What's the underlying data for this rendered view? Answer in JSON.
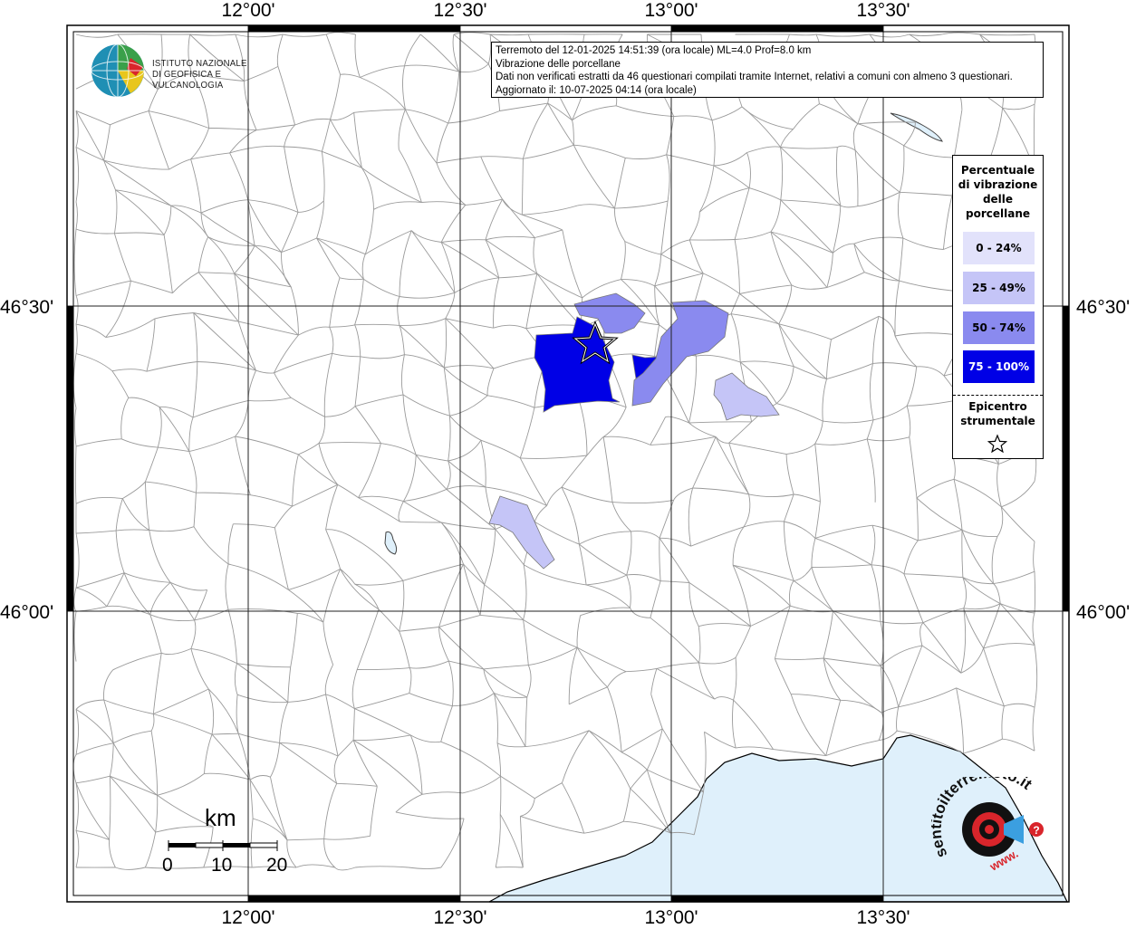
{
  "map": {
    "lon_labels": [
      "12°00'",
      "12°30'",
      "13°00'",
      "13°30'"
    ],
    "lat_labels": [
      "46°30'",
      "46°00'"
    ]
  },
  "info": {
    "line1": "Terremoto del 12-01-2025 14:51:39 (ora locale) ML=4.0 Prof=8.0 km",
    "line2": "Vibrazione delle porcellane",
    "line3": "Dati non verificati estratti da 46 questionari compilati tramite Internet, relativi a comuni con almeno 3 questionari.",
    "line4": "Aggiornato il: 10-07-2025 04:14 (ora locale)"
  },
  "logo": {
    "line1": "ISTITUTO NAZIONALE",
    "line2": "DI GEOFISICA E VULCANOLOGIA"
  },
  "legend": {
    "title_lines": [
      "Percentuale",
      "di vibrazione",
      "delle",
      "porcellane"
    ],
    "classes": [
      {
        "label": "0 - 24%",
        "color": "#e2e2fb"
      },
      {
        "label": "25 - 49%",
        "color": "#c5c5f7"
      },
      {
        "label": "50 - 74%",
        "color": "#8a8aef"
      },
      {
        "label": "75 - 100%",
        "color": "#0000e6"
      }
    ],
    "epicenter_lines": [
      "Epicentro",
      "strumentale"
    ],
    "epicenter_icon": "star-icon"
  },
  "scale_bar": {
    "unit": "km",
    "ticks": [
      "0",
      "10",
      "20"
    ]
  },
  "brand": {
    "text": "sentitoilterremoto.it",
    "prefix": "www.",
    "badge": "?",
    "colors": {
      "red": "#d9252b",
      "blue": "#3b9fe0",
      "black": "#111111"
    }
  },
  "colors": {
    "sea": "#dff0fb",
    "grid": "#222222",
    "boundary": "#9a9a9a"
  }
}
